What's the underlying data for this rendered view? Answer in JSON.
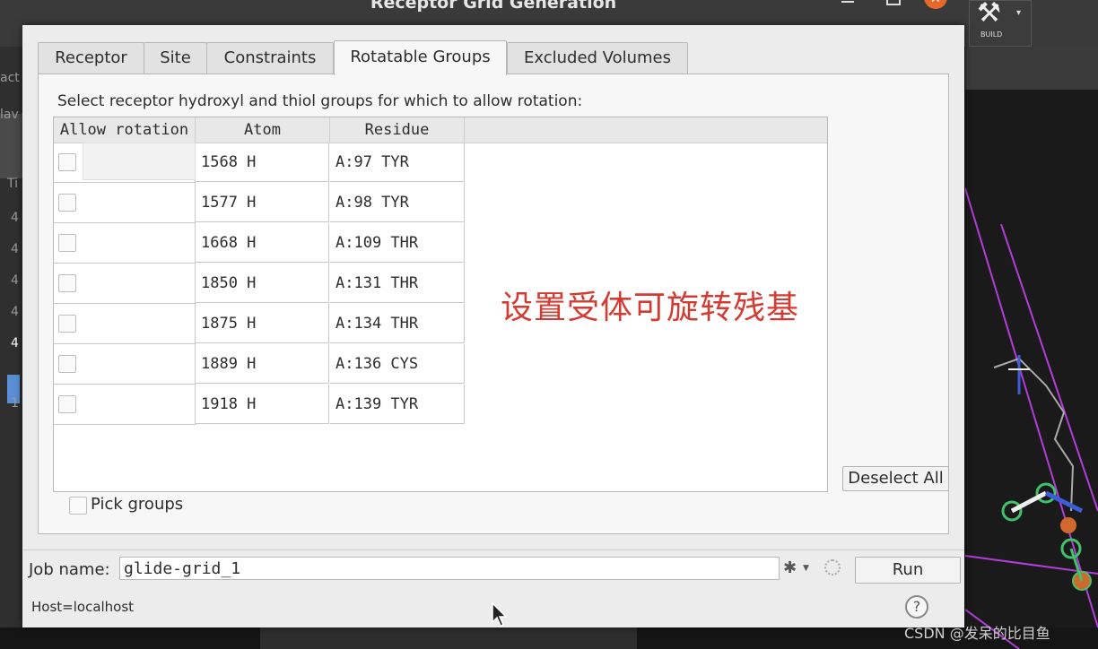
{
  "window": {
    "title": "Receptor Grid Generation",
    "build_label": "BUILD"
  },
  "background_sidebar": {
    "fragments": [
      "act",
      "lav",
      "Ti",
      "4",
      "4",
      "4",
      "4",
      "4",
      "1"
    ]
  },
  "tabs": [
    {
      "label": "Receptor",
      "active": false
    },
    {
      "label": "Site",
      "active": false
    },
    {
      "label": "Constraints",
      "active": false
    },
    {
      "label": "Rotatable Groups",
      "active": true
    },
    {
      "label": "Excluded Volumes",
      "active": false
    }
  ],
  "panel": {
    "instruction": "Select receptor hydroxyl and thiol groups for which to allow rotation:",
    "columns": [
      "Allow rotation",
      "Atom",
      "Residue"
    ],
    "rows": [
      {
        "allow": false,
        "atom": "1568 H",
        "residue": "A:97 TYR"
      },
      {
        "allow": false,
        "atom": "1577 H",
        "residue": "A:98 TYR"
      },
      {
        "allow": false,
        "atom": "1668 H",
        "residue": "A:109 THR"
      },
      {
        "allow": false,
        "atom": "1850 H",
        "residue": "A:131 THR"
      },
      {
        "allow": false,
        "atom": "1875 H",
        "residue": "A:134 THR"
      },
      {
        "allow": false,
        "atom": "1889 H",
        "residue": "A:136 CYS"
      },
      {
        "allow": false,
        "atom": "1918 H",
        "residue": "A:139 TYR"
      }
    ],
    "annotation": "设置受体可旋转残基",
    "deselect_all_label": "Deselect All",
    "pick_groups_label": "Pick groups",
    "pick_groups_checked": false
  },
  "job": {
    "name_label": "Job name:",
    "name_value": "glide-grid_1",
    "run_label": "Run",
    "host_text": "Host=localhost",
    "help_label": "?"
  },
  "watermark": "CSDN @发呆的比目鱼",
  "colors": {
    "dialog_bg": "#ececec",
    "annotation": "#d23c32",
    "close_button": "#e9692c",
    "viewer_line": "#b23ed8",
    "molecule_green": "#3fc36b"
  }
}
